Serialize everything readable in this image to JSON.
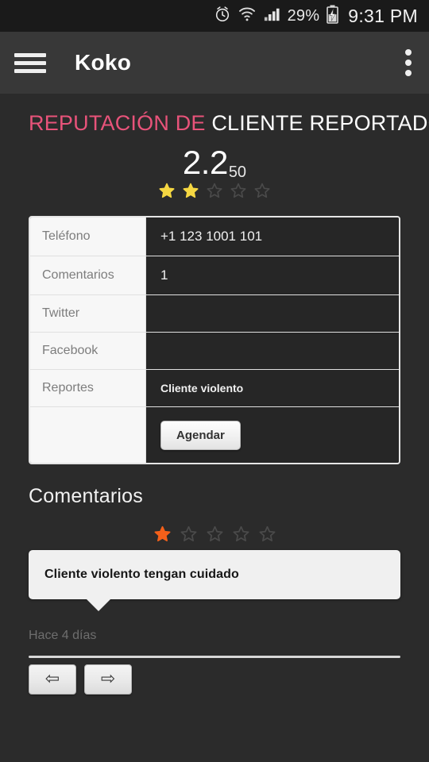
{
  "statusbar": {
    "alarm_icon": "alarm-clock-icon",
    "wifi_icon": "wifi-icon",
    "signal_icon": "cellular-signal-icon",
    "battery_percent": "29%",
    "battery_icon": "battery-charging-icon",
    "time": "9:31 PM"
  },
  "appbar": {
    "menu_icon": "hamburger-menu-icon",
    "title": "Koko",
    "overflow_icon": "overflow-menu-icon"
  },
  "reputation": {
    "prefix": "REPUTACIÓN DE",
    "subject": "CLIENTE REPORTADO",
    "score": "2.2",
    "score_sub": "50",
    "stars_filled": 2,
    "stars_total": 5,
    "star_color": "#f5d742",
    "star_empty_color": "#4a4a4a"
  },
  "details": {
    "rows": [
      {
        "label": "Teléfono",
        "value": "+1 123 1001 101",
        "bold": false
      },
      {
        "label": "Comentarios",
        "value": "1",
        "bold": false
      },
      {
        "label": "Twitter",
        "value": "",
        "bold": false
      },
      {
        "label": "Facebook",
        "value": "",
        "bold": false
      },
      {
        "label": "Reportes",
        "value": "Cliente violento",
        "bold": true
      }
    ],
    "action_label": "",
    "action_button": "Agendar"
  },
  "comments": {
    "section_title": "Comentarios",
    "rating_stars_filled": 1,
    "rating_stars_total": 5,
    "rating_star_color": "#f4601a",
    "rating_star_empty_color": "#4a4a4a",
    "text": "Cliente violento tengan cuidado",
    "timestamp": "Hace 4 días"
  },
  "pagination": {
    "prev_icon": "arrow-left-icon",
    "prev_glyph": "⇦",
    "next_icon": "arrow-right-icon",
    "next_glyph": "⇨"
  },
  "colors": {
    "page_bg": "#2b2b2b",
    "appbar_bg": "#383838",
    "statusbar_bg": "#1a1a1a",
    "accent_pink": "#e8537a"
  }
}
